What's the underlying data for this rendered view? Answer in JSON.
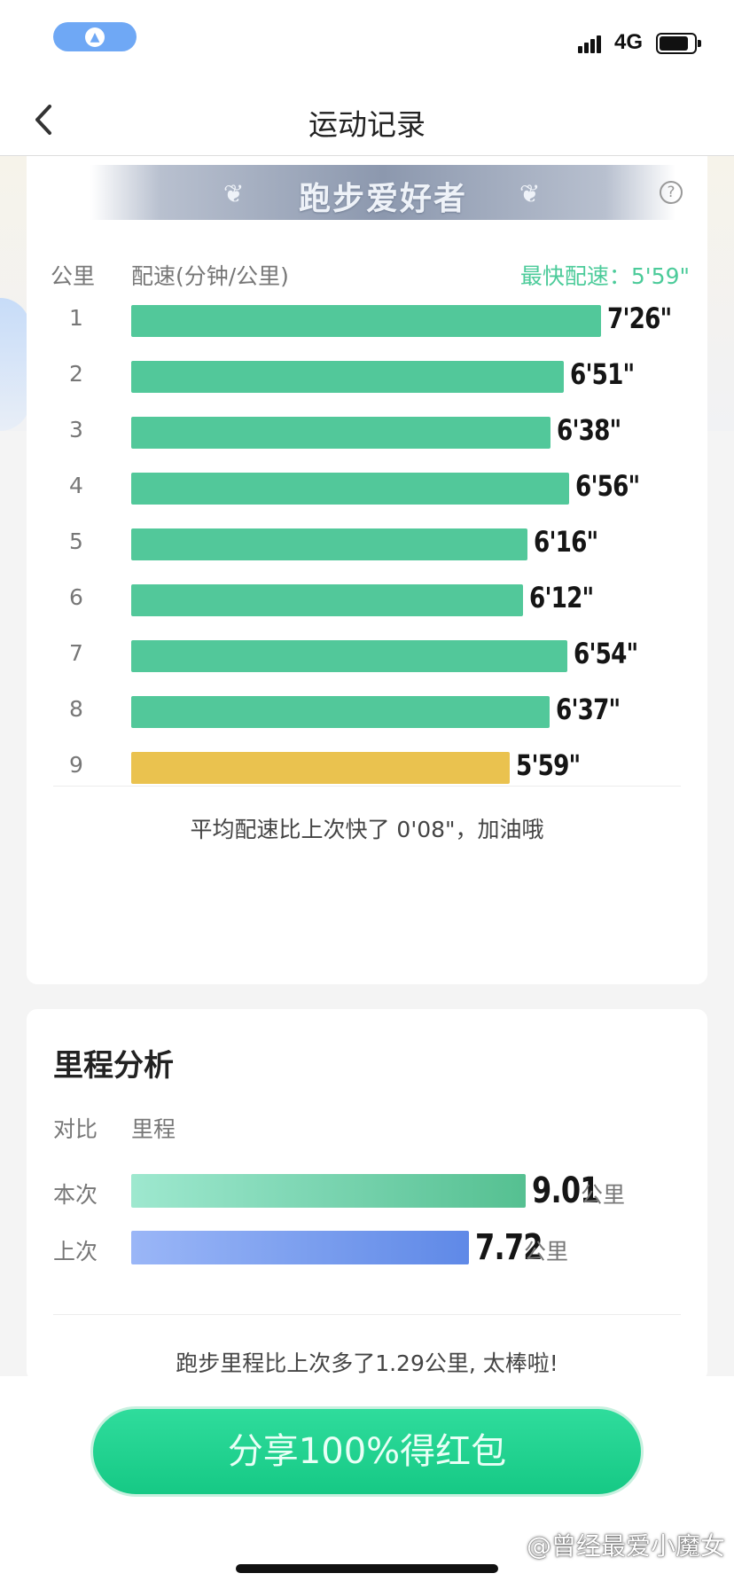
{
  "status_bar": {
    "network": "4G"
  },
  "title_bar": {
    "back_icon": "chevron-left-icon",
    "title": "运动记录"
  },
  "pace_card": {
    "badge_text": "跑步爱好者",
    "help_icon": "?",
    "header": {
      "km_label": "公里",
      "pace_label": "配速(分钟/公里)",
      "best_label": "最快配速：5'59\""
    },
    "rows": [
      {
        "km": "1",
        "pace": "7'26\"",
        "pace_seconds": 446,
        "best": false
      },
      {
        "km": "2",
        "pace": "6'51\"",
        "pace_seconds": 411,
        "best": false
      },
      {
        "km": "3",
        "pace": "6'38\"",
        "pace_seconds": 398,
        "best": false
      },
      {
        "km": "4",
        "pace": "6'56\"",
        "pace_seconds": 416,
        "best": false
      },
      {
        "km": "5",
        "pace": "6'16\"",
        "pace_seconds": 376,
        "best": false
      },
      {
        "km": "6",
        "pace": "6'12\"",
        "pace_seconds": 372,
        "best": false
      },
      {
        "km": "7",
        "pace": "6'54\"",
        "pace_seconds": 414,
        "best": false
      },
      {
        "km": "8",
        "pace": "6'37\"",
        "pace_seconds": 397,
        "best": false
      },
      {
        "km": "9",
        "pace": "5'59\"",
        "pace_seconds": 359,
        "best": true
      }
    ],
    "colors": {
      "normal": "#52c89a",
      "best": "#eac24f",
      "best_label": "#4ccb9a"
    },
    "summary": "平均配速比上次快了 0'08\"，加油哦"
  },
  "distance_card": {
    "title": "里程分析",
    "header": {
      "compare_label": "对比",
      "distance_label": "里程"
    },
    "rows": [
      {
        "label": "本次",
        "value": "9.01",
        "unit": "公里",
        "km": 9.01,
        "kind": "cur"
      },
      {
        "label": "上次",
        "value": "7.72",
        "unit": "公里",
        "km": 7.72,
        "kind": "prev"
      }
    ],
    "summary": "跑步里程比上次多了1.29公里, 太棒啦!"
  },
  "share_button": {
    "label": "分享100%得红包"
  },
  "watermark": "@曾经最爱小魔女"
}
